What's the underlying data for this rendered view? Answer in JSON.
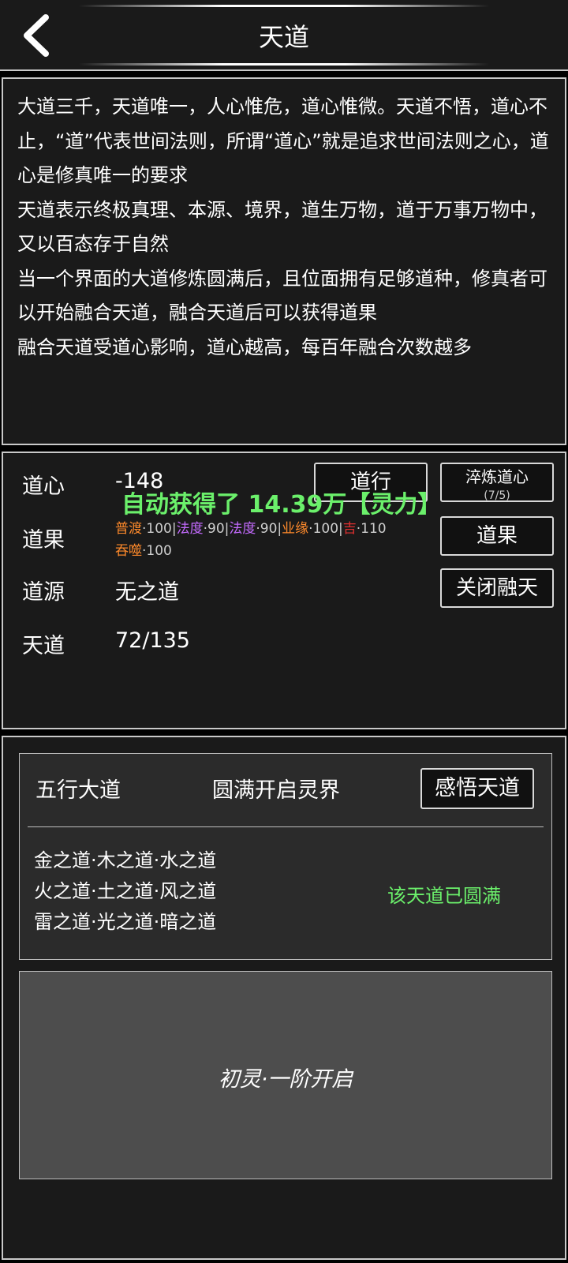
{
  "header": {
    "title": "天道"
  },
  "description": {
    "paragraphs": [
      "大道三千，天道唯一，人心惟危，道心惟微。天道不悟，道心不止，“道”代表世间法则，所谓“道心”就是追求世间法则之心，道心是修真唯一的要求",
      "天道表示终极真理、本源、境界，道生万物，道于万事万物中，又以百态存于自然",
      "当一个界面的大道修炼圆满后，且位面拥有足够道种，修真者可以开始融合天道，融合天道后可以获得道果",
      "融合天道受道心影响，道心越高，每百年融合次数越多"
    ]
  },
  "stats": {
    "daoxin": {
      "label": "道心",
      "value": "-148"
    },
    "daoguo": {
      "label": "道果",
      "items": [
        {
          "name": "普渡",
          "value": "100",
          "color": "#ff8a2b"
        },
        {
          "name": "法度",
          "value": "90",
          "color": "#c46bff"
        },
        {
          "name": "法度",
          "value": "90",
          "color": "#c46bff"
        },
        {
          "name": "业缘",
          "value": "100",
          "color": "#ff8a2b"
        },
        {
          "name": "吉",
          "value": "110",
          "color": "#e23030"
        },
        {
          "name": "吞噬",
          "value": "100",
          "color": "#ff8a2b"
        }
      ]
    },
    "daoyuan": {
      "label": "道源",
      "value": "无之道"
    },
    "tiandao": {
      "label": "天道",
      "value": "72/135"
    }
  },
  "buttons": {
    "daoxing": "道行",
    "cuilian": "淬炼道心",
    "cuilian_count": "(7/5)",
    "daoguo": "道果",
    "close_fusion": "关闭融天"
  },
  "toast": "自动获得了 14.39万【灵力】",
  "wuxing": {
    "title": "五行大道",
    "status": "圆满开启灵界",
    "button": "感悟天道",
    "rows": [
      [
        "金之道",
        "木之道",
        "水之道"
      ],
      [
        "火之道",
        "土之道",
        "风之道"
      ],
      [
        "雷之道",
        "光之道",
        "暗之道"
      ]
    ],
    "complete_text": "该天道已圆满"
  },
  "realm": {
    "label": "初灵·一阶开启"
  },
  "colors": {
    "accent_green": "#6bf06b",
    "panel_bg": "#1a1a1a",
    "border": "#c9c9c9"
  }
}
